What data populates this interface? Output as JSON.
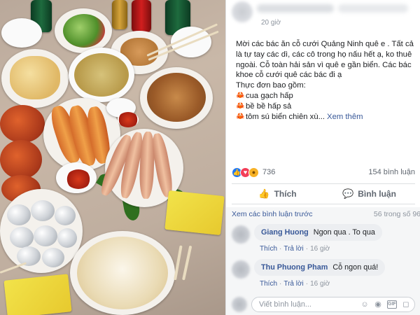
{
  "post": {
    "timestamp": "20 giờ",
    "text_line1": "Mời các bác ăn cỗ cưới Quảng Ninh quê e . Tất cả là tự tay các dì, các cô trong họ nấu hết ạ, ko thuê ngoài. Cỗ toàn hải sản vì quê e gần biển. Các bác khoe cỗ cưới quê các bác đi ạ",
    "menu_heading": "Thực đơn bao gồm:",
    "dishes": [
      "cua gạch hấp",
      "bề bề hấp sả",
      "tôm sú biển chiên xù..."
    ],
    "see_more": "Xem thêm",
    "reaction_count": "736",
    "comment_count": "154 bình luận",
    "reaction_icons": [
      "like-icon",
      "love-icon",
      "wow-icon"
    ],
    "crab_icon": "crab-icon"
  },
  "actions": {
    "like_label": "Thích",
    "comment_label": "Bình luận"
  },
  "comments_section": {
    "view_previous": "Xem các bình luận trước",
    "count_text": "56 trong số 96",
    "items": [
      {
        "name": "Giang Huong",
        "text": "Ngon qua . To qua",
        "like": "Thích",
        "reply": "Trả lời",
        "time": "16 giờ"
      },
      {
        "name": "Thu Phuong Pham",
        "text": "Cỗ ngon quá!",
        "like": "Thích",
        "reply": "Trả lời",
        "time": "16 giờ"
      }
    ],
    "write_placeholder": "Viết bình luận...",
    "input_icons": [
      "emoji-icon",
      "camera-icon",
      "gif-icon",
      "sticker-icon"
    ]
  },
  "colors": {
    "link": "#385898",
    "like_blue": "#2078f4",
    "love_red": "#f33e58",
    "wow_yellow": "#f7b125",
    "meta_gray": "#8d949e"
  }
}
